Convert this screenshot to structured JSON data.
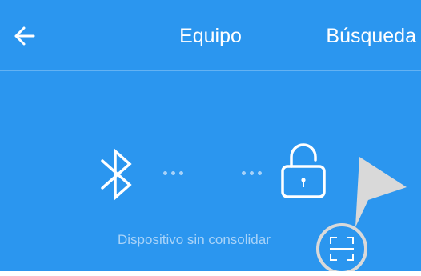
{
  "header": {
    "title": "Equipo",
    "search_label": "Búsqueda",
    "back_icon": "arrow-left-icon"
  },
  "connection": {
    "left_icon": "bluetooth-icon",
    "right_icon": "unlocked-padlock-icon",
    "status_text": "Dispositivo sin consolidar",
    "scan_icon": "scan-icon"
  },
  "colors": {
    "primary": "#2b96ef",
    "text_light": "#a9d3f8",
    "white": "#ffffff",
    "pointer": "#d9d9d9"
  }
}
